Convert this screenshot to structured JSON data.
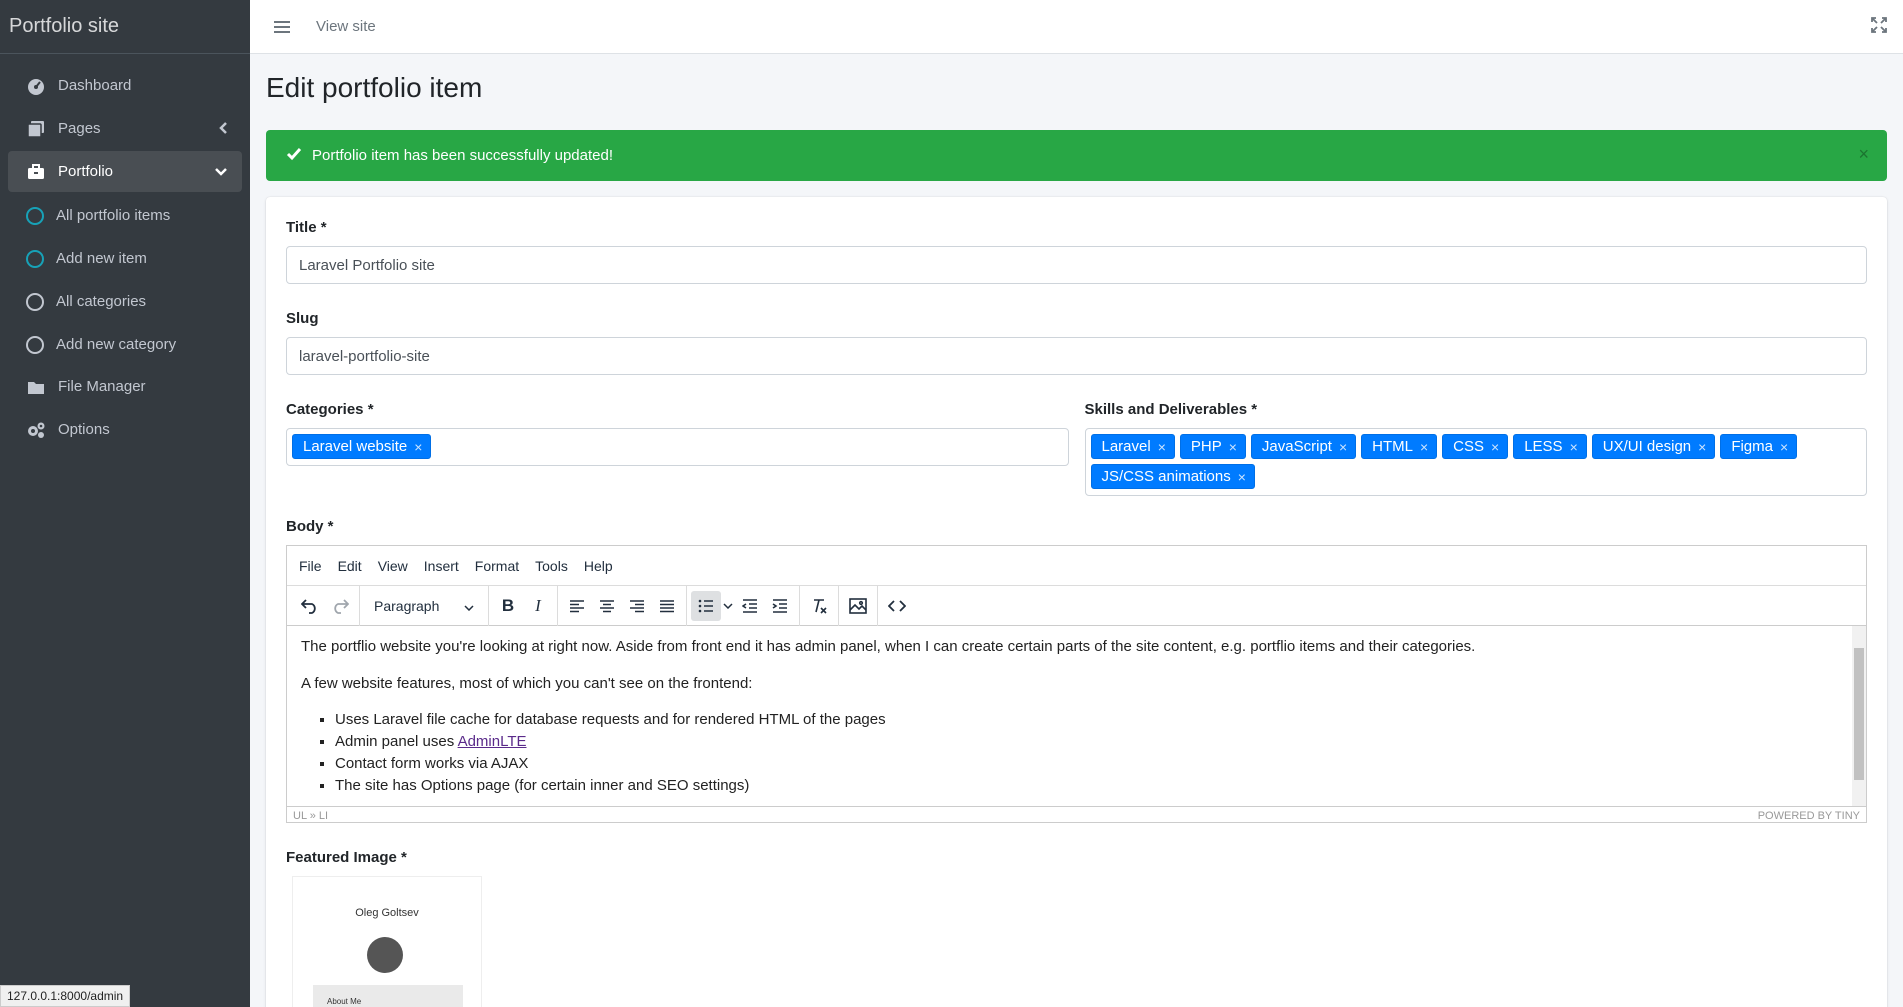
{
  "brand": "Portfolio site",
  "sidebar": {
    "items": [
      {
        "label": "Dashboard",
        "icon": "dashboard-icon"
      },
      {
        "label": "Pages",
        "icon": "pages-icon"
      },
      {
        "label": "Portfolio",
        "icon": "briefcase-icon"
      },
      {
        "label": "All portfolio items",
        "icon": "circle-icon"
      },
      {
        "label": "Add new item",
        "icon": "circle-icon"
      },
      {
        "label": "All categories",
        "icon": "circle-icon"
      },
      {
        "label": "Add new category",
        "icon": "circle-icon"
      },
      {
        "label": "File Manager",
        "icon": "folder-icon"
      },
      {
        "label": "Options",
        "icon": "cogs-icon"
      }
    ]
  },
  "topbar": {
    "view_site": "View site"
  },
  "page": {
    "title": "Edit portfolio item"
  },
  "alert": {
    "message": "Portfolio item has been successfully updated!",
    "close": "×"
  },
  "form": {
    "title_label": "Title *",
    "title_value": "Laravel Portfolio site",
    "slug_label": "Slug",
    "slug_value": "laravel-portfolio-site",
    "categories_label": "Categories *",
    "categories": [
      "Laravel website"
    ],
    "skills_label": "Skills and Deliverables *",
    "skills": [
      "Laravel",
      "PHP",
      "JavaScript",
      "HTML",
      "CSS",
      "LESS",
      "UX/UI design",
      "Figma",
      "JS/CSS animations"
    ],
    "body_label": "Body *",
    "featured_label": "Featured Image *"
  },
  "editor": {
    "menu": [
      "File",
      "Edit",
      "View",
      "Insert",
      "Format",
      "Tools",
      "Help"
    ],
    "block_format": "Paragraph",
    "p1": "The portflio website you're looking at right now. Aside from front end it has admin panel, when I can create certain parts of the site content, e.g. portflio items and their categories.",
    "p2": "A few website features, most of which you can't see on the frontend:",
    "li1": "Uses Laravel file cache for database requests and for rendered HTML of the pages",
    "li2_prefix": "Admin panel uses ",
    "li2_link": "AdminLTE",
    "li3": "Contact form works via AJAX",
    "li4": "The site has Options page (for certain inner and SEO settings)",
    "path": "UL » LI",
    "powered": "POWERED BY TINY"
  },
  "image": {
    "name": "Oleg Goltsev",
    "about": "About Me"
  },
  "status_url": "127.0.0.1:8000/admin",
  "colors": {
    "sidebar": "#343a40",
    "success": "#28a745",
    "primary": "#007bff"
  }
}
